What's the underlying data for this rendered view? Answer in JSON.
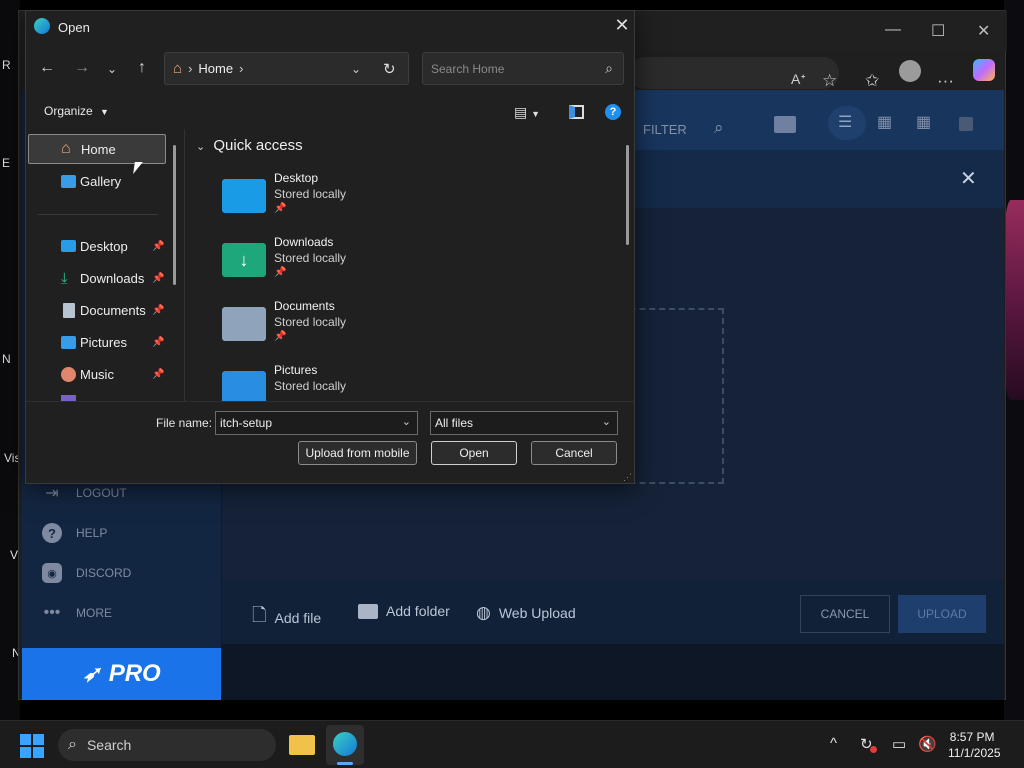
{
  "desktop": {
    "left_labels": [
      "R",
      "E",
      "N",
      "Vis",
      "V",
      "N"
    ]
  },
  "browser": {
    "read_aloud_icon": "read-aloud-icon",
    "favorite_icon": "star-icon",
    "favorites_icon": "favorites-icon",
    "profile_icon": "profile-icon",
    "more_icon": "more-icon",
    "copilot_icon": "copilot-icon"
  },
  "site": {
    "toolbar_filter": "FILTER",
    "sidebar": [
      {
        "label": "LOGOUT",
        "icon": "logout-icon"
      },
      {
        "label": "HELP",
        "icon": "help-icon"
      },
      {
        "label": "DISCORD",
        "icon": "discord-icon"
      },
      {
        "label": "MORE",
        "icon": "more-icon"
      }
    ],
    "pro_label": "PRO",
    "bottom": {
      "add_file": "Add file",
      "add_folder": "Add folder",
      "web_upload": "Web Upload",
      "cancel": "CANCEL",
      "upload": "UPLOAD"
    }
  },
  "dialog": {
    "title": "Open",
    "breadcrumb": "Home",
    "search_placeholder": "Search Home",
    "organize": "Organize",
    "nav_items": [
      {
        "label": "Home",
        "selected": true
      },
      {
        "label": "Gallery"
      },
      {
        "label": "Desktop",
        "pinned": true
      },
      {
        "label": "Downloads",
        "pinned": true
      },
      {
        "label": "Documents",
        "pinned": true
      },
      {
        "label": "Pictures",
        "pinned": true
      },
      {
        "label": "Music",
        "pinned": true
      }
    ],
    "quick_access_heading": "Quick access",
    "quick_access": [
      {
        "name": "Desktop",
        "status": "Stored locally",
        "color": "#1a9be6"
      },
      {
        "name": "Downloads",
        "status": "Stored locally",
        "color": "#1fa77c"
      },
      {
        "name": "Documents",
        "status": "Stored locally",
        "color": "#8fa3bb"
      },
      {
        "name": "Pictures",
        "status": "Stored locally",
        "color": "#2a8ee0"
      }
    ],
    "file_name_label": "File name:",
    "file_name_value": "itch-setup",
    "file_type_value": "All files",
    "buttons": {
      "upload_mobile": "Upload from mobile",
      "open": "Open",
      "cancel": "Cancel"
    }
  },
  "taskbar": {
    "search_label": "Search",
    "time": "8:57 PM",
    "date": "11/1/2025"
  }
}
